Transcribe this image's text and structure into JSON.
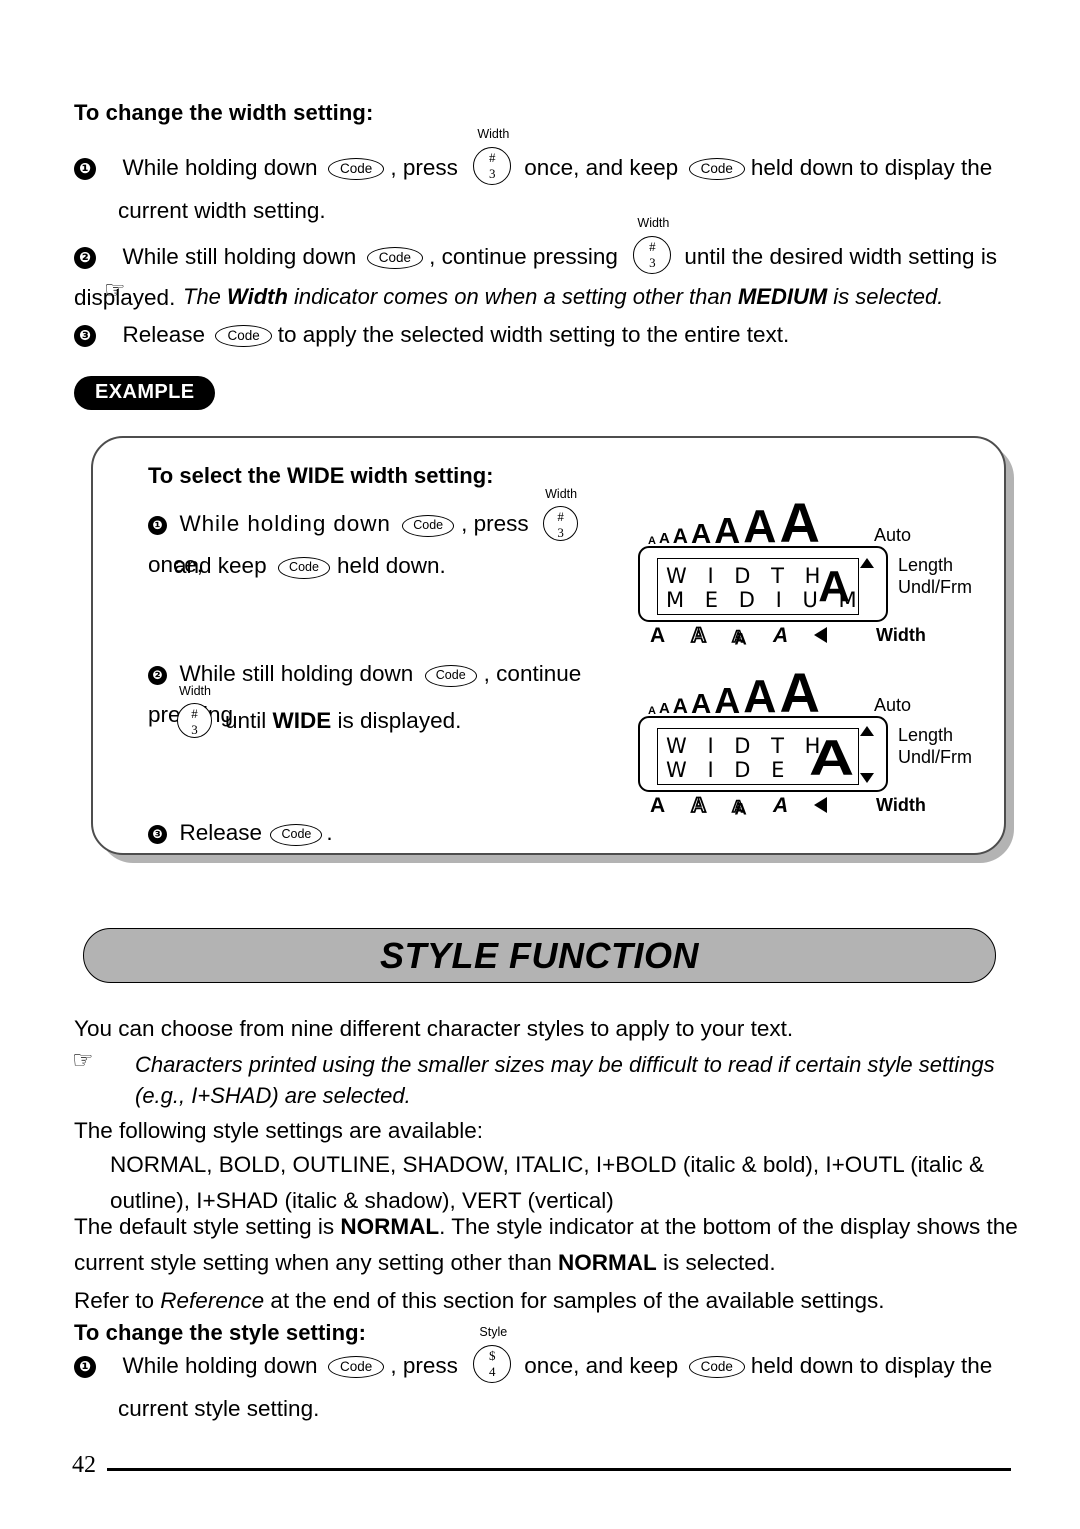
{
  "page": {
    "number": "42"
  },
  "section_width": {
    "heading": "To change the width setting:",
    "steps": [
      {
        "num": "❶",
        "p1": "While holding down",
        "key1": "Code",
        "p2": ", press",
        "key2_label": "Width",
        "key2_top": "#",
        "key2_bottom": "3",
        "p3": "once, and keep",
        "key3": "Code",
        "p4": "held down to display the",
        "p5": "current width setting."
      },
      {
        "num": "❷",
        "p1": "While still holding down",
        "key1": "Code",
        "p2": ", continue pressing",
        "key2_label": "Width",
        "key2_top": "#",
        "key2_bottom": "3",
        "p3": "until the desired width setting is displayed."
      },
      {
        "num": "❸",
        "p1": "Release",
        "key1": "Code",
        "p2": "to apply the selected width setting to the entire text."
      }
    ],
    "note": {
      "icon": "pointing-hand",
      "pre": "The ",
      "bold1": "Width",
      "mid": " indicator comes on when a setting other than ",
      "bold2": "MEDIUM",
      "post": " is selected."
    }
  },
  "example": {
    "badge": "EXAMPLE",
    "heading": "To select the WIDE width setting:",
    "steps": [
      {
        "num": "❶",
        "p1": "While holding down",
        "key1": "Code",
        "p2": ", press",
        "key2_label": "Width",
        "key2_top": "#",
        "key2_bottom": "3",
        "p3": "once,",
        "p4": "and keep",
        "key3": "Code",
        "p5": "held down."
      },
      {
        "num": "❷",
        "p1": "While still holding down",
        "key1": "Code",
        "p2": ", continue pressing",
        "key2_label": "Width",
        "key2_top": "#",
        "key2_bottom": "3",
        "p3_pre": "until ",
        "p3_bold": "WIDE",
        "p3_post": " is displayed."
      },
      {
        "num": "❸",
        "p1": "Release",
        "key1": "Code",
        "p2": "."
      }
    ],
    "displays": [
      {
        "name": "lcd-medium",
        "size_marks": [
          "A",
          "A",
          "A",
          "A",
          "A",
          "A",
          "A"
        ],
        "line1": "W I D T H",
        "line2": "M E D I U M",
        "big_char": "A",
        "auto_label": "Auto",
        "length_label": "Length",
        "undlfrm_label": "Undl/Frm",
        "width_label": "Width",
        "width_label_bold": false,
        "arrow_up": true,
        "arrow_down": false,
        "style_marks": [
          "A",
          "A",
          "A",
          "A",
          "◀"
        ]
      },
      {
        "name": "lcd-wide",
        "size_marks": [
          "A",
          "A",
          "A",
          "A",
          "A",
          "A",
          "A"
        ],
        "line1": "W I D T H",
        "line2": "W I D E",
        "big_char": "A",
        "auto_label": "Auto",
        "length_label": "Length",
        "undlfrm_label": "Undl/Frm",
        "width_label": "Width",
        "width_label_bold": true,
        "arrow_up": true,
        "arrow_down": true,
        "style_marks": [
          "A",
          "A",
          "A",
          "A",
          "◀"
        ]
      }
    ]
  },
  "style_section": {
    "banner": "STYLE FUNCTION",
    "intro": "You can choose from nine different character styles to apply to your text.",
    "note": {
      "icon": "pointing-hand",
      "line1": "Characters printed using the smaller sizes may be difficult to read if certain style settings",
      "line2": "(e.g., I+SHAD) are selected."
    },
    "available_lead": "The following style settings are available:",
    "available_list": "NORMAL, BOLD, OUTLINE, SHADOW, ITALIC, I+BOLD (italic & bold), I+OUTL (italic & outline), I+SHAD (italic & shadow), VERT (vertical)",
    "default_pre": "The default style setting is ",
    "default_bold1": "NORMAL",
    "default_mid": ". The style indicator at the bottom of the display shows the current style setting when any setting other than ",
    "default_bold2": "NORMAL",
    "default_post": " is selected.",
    "refer_pre": "Refer to ",
    "refer_italic": "Reference",
    "refer_post": " at the end of this section for samples of the available settings.",
    "heading": "To change the style setting:",
    "step": {
      "num": "❶",
      "p1": "While holding down",
      "key1": "Code",
      "p2": ", press",
      "key2_label": "Style",
      "key2_top": "$",
      "key2_bottom": "4",
      "p3": "once, and keep",
      "key3": "Code",
      "p4": "held down to display the",
      "p5": "current style setting."
    }
  }
}
